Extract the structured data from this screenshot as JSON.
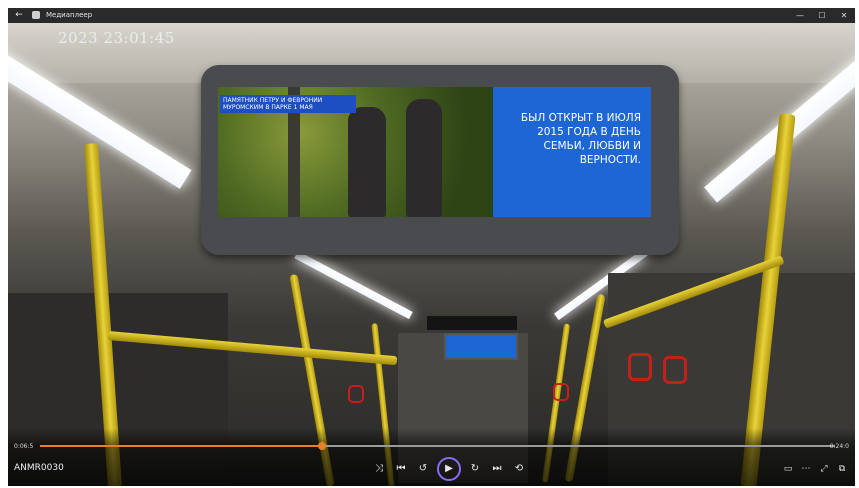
{
  "window": {
    "title": "Медиаплеер",
    "back_icon": "←",
    "controls": {
      "minimize": "—",
      "maximize": "☐",
      "close": "✕"
    }
  },
  "video": {
    "timestamp": "2023 23:01:45",
    "display": {
      "caption": "Памятник Петру и Февронии Муромским в парке 1 мая",
      "message": "Был открыт в июля 2015 года в день семьи, любви и верности."
    }
  },
  "player": {
    "time_elapsed": "0:06:5",
    "time_total": "0:24:0",
    "progress": 0.355,
    "filename": "ANMR0030",
    "buttons": {
      "shuffle": "⤨",
      "previous": "⏮",
      "rewind": "↺",
      "play": "▶",
      "forward": "↻",
      "next": "⏭",
      "repeat": "⟲",
      "cast": "▭",
      "more": "⋯",
      "fullscreen": "⤢",
      "miniplayer": "⧉"
    },
    "accent_color": "#e87f2a",
    "play_ring_color": "#8a6df0"
  }
}
